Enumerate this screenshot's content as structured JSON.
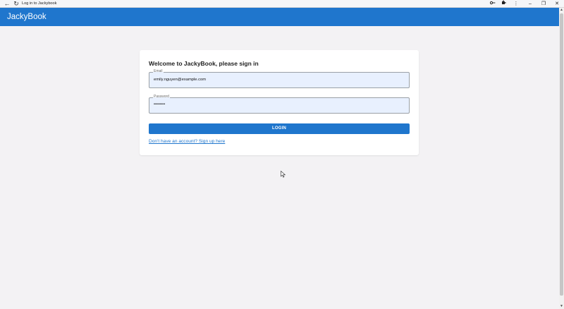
{
  "browser": {
    "tab_title": "Log in to Jackybook",
    "window_controls": {
      "minimize": "–",
      "restore": "❐",
      "close": "✕"
    }
  },
  "app": {
    "brand": "JackyBook"
  },
  "login_card": {
    "heading": "Welcome to JackyBook, please sign in",
    "email": {
      "label": "Email",
      "value": "emily.nguyen@example.com"
    },
    "password": {
      "label": "Password",
      "value": "••••••••"
    },
    "login_button": "LOGIN",
    "signup_link": "Don't have an account? Sign up here"
  },
  "colors": {
    "primary": "#1f76cd",
    "field_fill": "#e8f0fe",
    "page_bg": "#f3f2f4"
  }
}
